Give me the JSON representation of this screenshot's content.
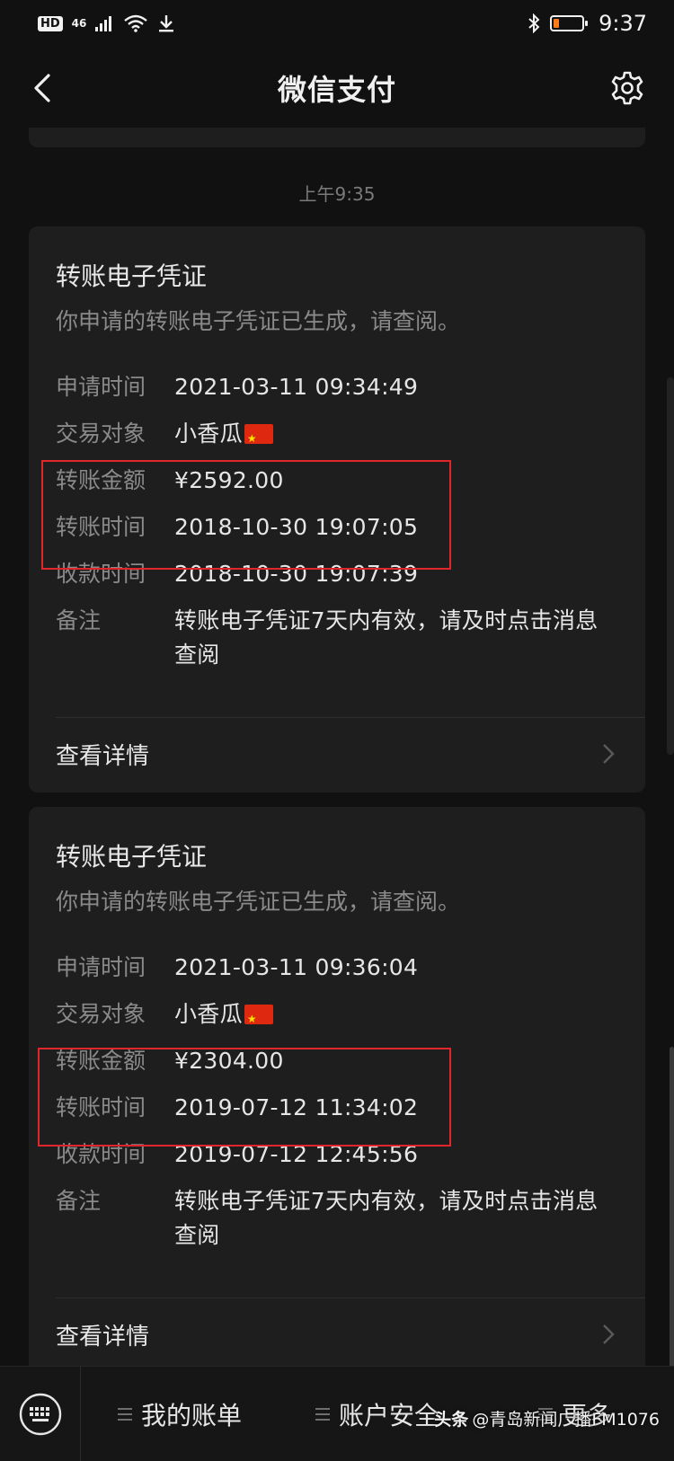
{
  "status_bar": {
    "hd": "HD",
    "network": "46",
    "time": "9:37"
  },
  "header": {
    "title": "微信支付"
  },
  "timestamp": "上午9:35",
  "cards": [
    {
      "title": "转账电子凭证",
      "subtitle": "你申请的转账电子凭证已生成，请查阅。",
      "rows": [
        {
          "label": "申请时间",
          "value": "2021-03-11 09:34:49"
        },
        {
          "label": "交易对象",
          "value": "小香瓜"
        },
        {
          "label": "转账金额",
          "value": "¥2592.00"
        },
        {
          "label": "转账时间",
          "value": "2018-10-30 19:07:05"
        },
        {
          "label": "收款时间",
          "value": "2018-10-30 19:07:39"
        },
        {
          "label": "备注",
          "value": "转账电子凭证7天内有效，请及时点击消息查阅"
        }
      ],
      "detail_label": "查看详情"
    },
    {
      "title": "转账电子凭证",
      "subtitle": "你申请的转账电子凭证已生成，请查阅。",
      "rows": [
        {
          "label": "申请时间",
          "value": "2021-03-11 09:36:04"
        },
        {
          "label": "交易对象",
          "value": "小香瓜"
        },
        {
          "label": "转账金额",
          "value": "¥2304.00"
        },
        {
          "label": "转账时间",
          "value": "2019-07-12 11:34:02"
        },
        {
          "label": "收款时间",
          "value": "2019-07-12 12:45:56"
        },
        {
          "label": "备注",
          "value": "转账电子凭证7天内有效，请及时点击消息查阅"
        }
      ],
      "detail_label": "查看详情"
    }
  ],
  "bottom_menu": {
    "items": [
      {
        "label": "我的账单"
      },
      {
        "label": "账户安全"
      },
      {
        "label": "更多"
      }
    ]
  },
  "watermark": {
    "logo": "头条",
    "text": "@青岛新闻广播FM1076"
  },
  "colors": {
    "background": "#111111",
    "card": "#1e1e1e",
    "highlight": "#e0262b",
    "battery_low": "#ff7a1a"
  }
}
